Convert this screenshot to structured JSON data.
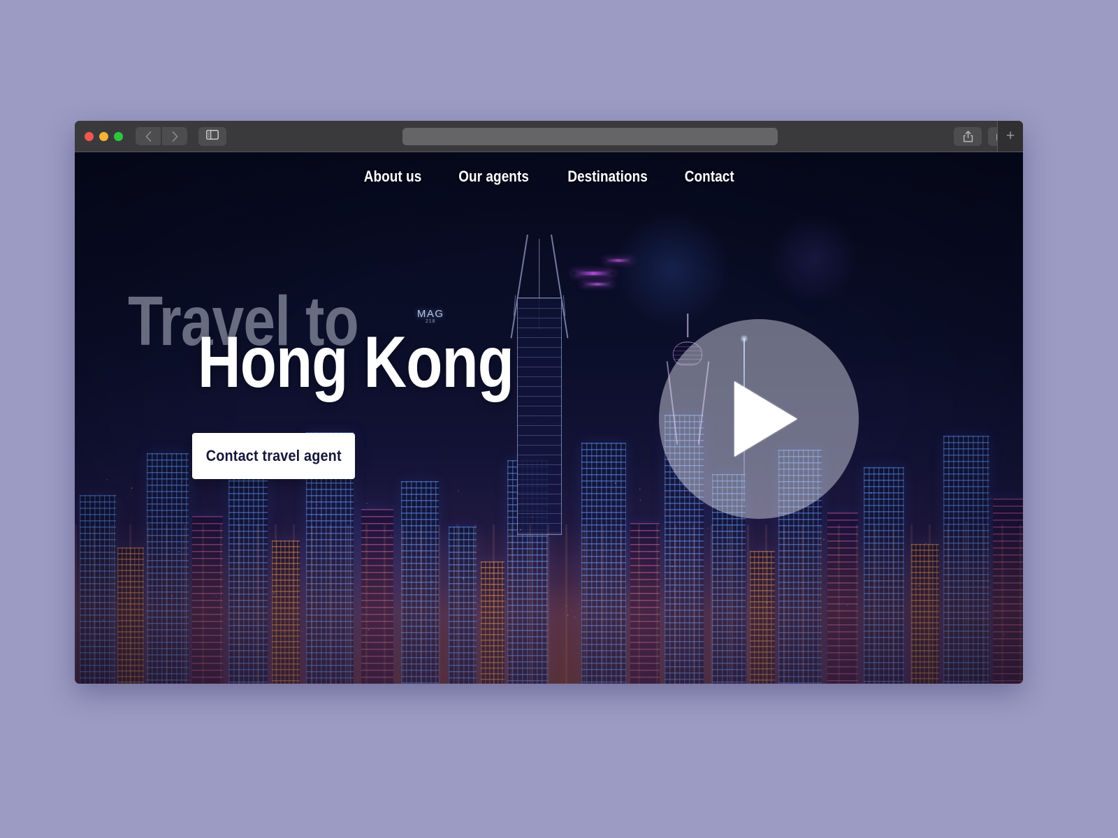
{
  "desktop": {
    "background_color": "#9b9bc4"
  },
  "browser": {
    "traffic_lights": {
      "close_label": "close",
      "minimize_label": "minimize",
      "zoom_label": "zoom",
      "close_color": "#f2564f",
      "minimize_color": "#f5b333",
      "zoom_color": "#2ec63f"
    },
    "back_icon": "chevron-left-icon",
    "forward_icon": "chevron-right-icon",
    "sidebar_icon": "sidebar-toggle-icon",
    "share_icon": "share-icon",
    "tab_overview_icon": "tab-overview-icon",
    "new_tab_label": "+",
    "address_bar": {
      "value": "",
      "placeholder": ""
    }
  },
  "site": {
    "nav": [
      {
        "label": "About us"
      },
      {
        "label": "Our agents"
      },
      {
        "label": "Destinations"
      },
      {
        "label": "Contact"
      }
    ],
    "hero": {
      "kicker": "Travel to",
      "title": "Hong Kong",
      "cta_label": "Contact travel agent",
      "kicker_color": "#d4d8e8",
      "title_color": "#ffffff",
      "cta_bg": "#ffffff",
      "cta_text_color": "#16173a"
    },
    "video": {
      "play_label": "Play video",
      "play_icon": "play-triangle-icon"
    },
    "background_image": {
      "scene": "Hong Kong skyline at night",
      "sign_text": "MAG",
      "sign_subtext": "218",
      "sky_color": "#080b20"
    }
  }
}
